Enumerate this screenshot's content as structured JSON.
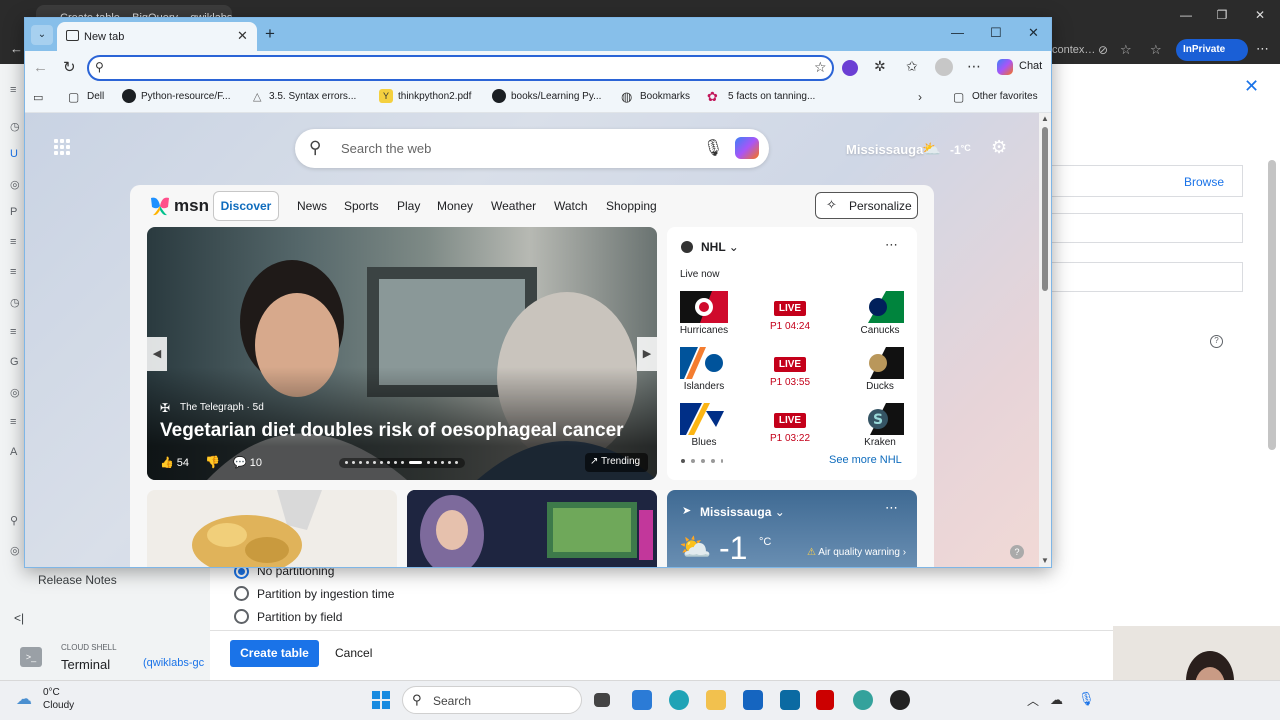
{
  "background_browser": {
    "tab_title": "Create table – BigQuery – qwiklabs-gcp…",
    "address_fragment": "contex…",
    "inprivate_label": "InPrivate",
    "browse_label": "Browse",
    "release_notes": "Release Notes",
    "collapse": "<|",
    "cloud_shell_label": "CLOUD SHELL",
    "terminal_label": "Terminal",
    "terminal_project": "(qwiklabs-gc",
    "partition_options": [
      {
        "label": "No partitioning",
        "selected": true
      },
      {
        "label": "Partition by ingestion time",
        "selected": false
      },
      {
        "label": "Partition by field",
        "selected": false
      }
    ],
    "create_table_label": "Create table",
    "cancel_label": "Cancel"
  },
  "taskbar": {
    "temp": "0°C",
    "condition": "Cloudy",
    "search_label": "Search"
  },
  "edge": {
    "tab_title": "New tab",
    "chat_label": "Chat",
    "address_value": "",
    "bookmarks": [
      {
        "label": "Dell",
        "icon": "folder-icon"
      },
      {
        "label": "Python-resource/F...",
        "icon": "github-icon"
      },
      {
        "label": "3.5. Syntax errors...",
        "icon": "triangle-icon"
      },
      {
        "label": "thinkpython2.pdf",
        "icon": "doc-icon"
      },
      {
        "label": "books/Learning Py...",
        "icon": "github-icon"
      },
      {
        "label": "Bookmarks",
        "icon": "globe-icon"
      },
      {
        "label": "5 facts on tanning...",
        "icon": "flower-icon"
      }
    ],
    "other_favorites": "Other favorites"
  },
  "ntp": {
    "search_placeholder": "Search the web",
    "location": "Mississauga",
    "temperature": "-1",
    "temp_unit": "°C"
  },
  "msn": {
    "logo": "msn",
    "nav": [
      "Discover",
      "News",
      "Sports",
      "Play",
      "Money",
      "Weather",
      "Watch",
      "Shopping"
    ],
    "personalize": "Personalize",
    "hero": {
      "source": "The Telegraph · 5d",
      "title": "Vegetarian diet doubles risk of oesophageal cancer",
      "likes": "54",
      "comments": "10",
      "trending": "Trending"
    },
    "nhl": {
      "title": "NHL",
      "live_now": "Live now",
      "live_badge": "LIVE",
      "games": [
        {
          "home": "Hurricanes",
          "away": "Canucks",
          "period": "P1 04:24"
        },
        {
          "home": "Islanders",
          "away": "Ducks",
          "period": "P1 03:55"
        },
        {
          "home": "Blues",
          "away": "Kraken",
          "period": "P1 03:22"
        }
      ],
      "see_more": "See more NHL"
    },
    "weather_card": {
      "location": "Mississauga",
      "temp": "-1",
      "unit": "°C",
      "warning": "Air quality warning"
    }
  }
}
